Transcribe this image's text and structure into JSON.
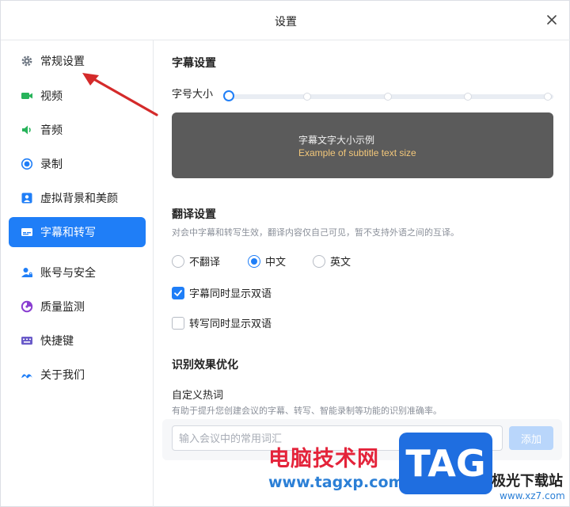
{
  "window": {
    "title": "设置"
  },
  "sidebar": {
    "items": [
      {
        "label": "常规设置",
        "icon": "gear-icon",
        "active": false
      },
      {
        "label": "视频",
        "icon": "video-camera-icon",
        "active": false
      },
      {
        "label": "音频",
        "icon": "speaker-icon",
        "active": false
      },
      {
        "label": "录制",
        "icon": "record-icon",
        "active": false
      },
      {
        "label": "虚拟背景和美颜",
        "icon": "person-portrait-icon",
        "active": false
      },
      {
        "label": "字幕和转写",
        "icon": "subtitle-icon",
        "active": true
      },
      {
        "label": "账号与安全",
        "icon": "account-lock-icon",
        "active": false
      },
      {
        "label": "质量监测",
        "icon": "quality-gauge-icon",
        "active": false
      },
      {
        "label": "快捷键",
        "icon": "keyboard-icon",
        "active": false
      },
      {
        "label": "关于我们",
        "icon": "brand-logo-icon",
        "active": false
      }
    ]
  },
  "subtitle": {
    "section_title": "字幕设置",
    "font_size_label": "字号大小",
    "font_size_level": 1,
    "font_size_levels": 5,
    "preview_zh": "字幕文字大小示例",
    "preview_en": "Example of subtitle text size"
  },
  "translation": {
    "section_title": "翻译设置",
    "description": "对会中字幕和转写生效，翻译内容仅自己可见，暂不支持外语之间的互译。",
    "options": [
      "不翻译",
      "中文",
      "英文"
    ],
    "selected": "中文",
    "bilingual_subtitle_label": "字幕同时显示双语",
    "bilingual_subtitle_checked": true,
    "bilingual_transcript_label": "转写同时显示双语",
    "bilingual_transcript_checked": false
  },
  "recognition": {
    "section_title": "识别效果优化",
    "hotwords_label": "自定义热词",
    "hotwords_description": "有助于提升您创建会议的字幕、转写、智能录制等功能的识别准确率。",
    "input_placeholder": "输入会议中的常用词汇",
    "input_value": "",
    "add_label": "添加"
  },
  "watermark": {
    "cn_text": "电脑技术网",
    "url_text": "www.tagxp.com",
    "tag_text": "TAG",
    "site_text": "极光下载站",
    "site_url": "www.xz7.com"
  },
  "colors": {
    "accent": "#1f7ef7",
    "annotation_arrow": "#d42a2a"
  }
}
